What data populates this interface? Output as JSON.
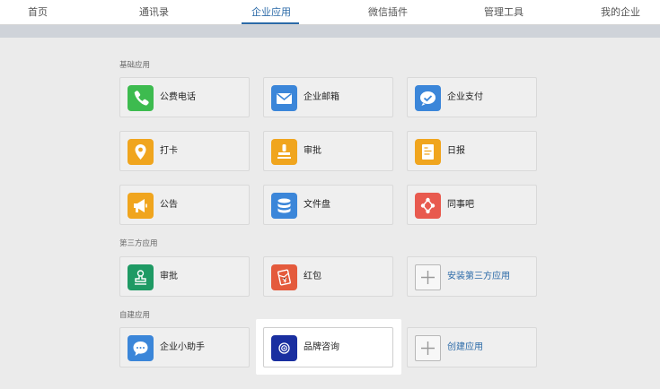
{
  "nav": {
    "items": [
      "首页",
      "通讯录",
      "企业应用",
      "微信插件",
      "管理工具",
      "我的企业"
    ],
    "active": "企业应用"
  },
  "sections": {
    "basic": "基础应用",
    "third": "第三方应用",
    "custom": "自建应用"
  },
  "apps": {
    "phone": "公费电话",
    "email": "企业邮箱",
    "pay": "企业支付",
    "checkin": "打卡",
    "approval": "审批",
    "daily": "日报",
    "notice": "公告",
    "disk": "文件盘",
    "bar": "同事吧",
    "approval3": "审批",
    "redpack": "红包",
    "install3": "安装第三方应用",
    "assistant": "企业小助手",
    "brand": "品牌咨询",
    "create": "创建应用"
  },
  "colors": {
    "phone": "#3dbb4f",
    "email": "#3b86d9",
    "pay": "#3b86d9",
    "checkin": "#f0a51e",
    "approval": "#f0a51e",
    "daily": "#f0a51e",
    "notice": "#f0a51e",
    "disk": "#3b86d9",
    "bar": "#e85a4f",
    "approval3": "#1f9a64",
    "redpack": "#e45a3c",
    "assistant": "#3b86d9",
    "brand": "#1a2fa0",
    "accent": "#2b6aa8"
  },
  "icons": {
    "phone": "phone-icon",
    "email": "envelope-icon",
    "pay": "pay-check-icon",
    "checkin": "location-pin-icon",
    "approval": "stamp-icon",
    "daily": "report-icon",
    "notice": "megaphone-icon",
    "disk": "database-icon",
    "bar": "share-network-icon",
    "approval3": "stamp-icon",
    "redpack": "red-envelope-icon",
    "install3": "plus-icon",
    "assistant": "chat-bubble-icon",
    "brand": "target-icon",
    "create": "plus-icon"
  }
}
